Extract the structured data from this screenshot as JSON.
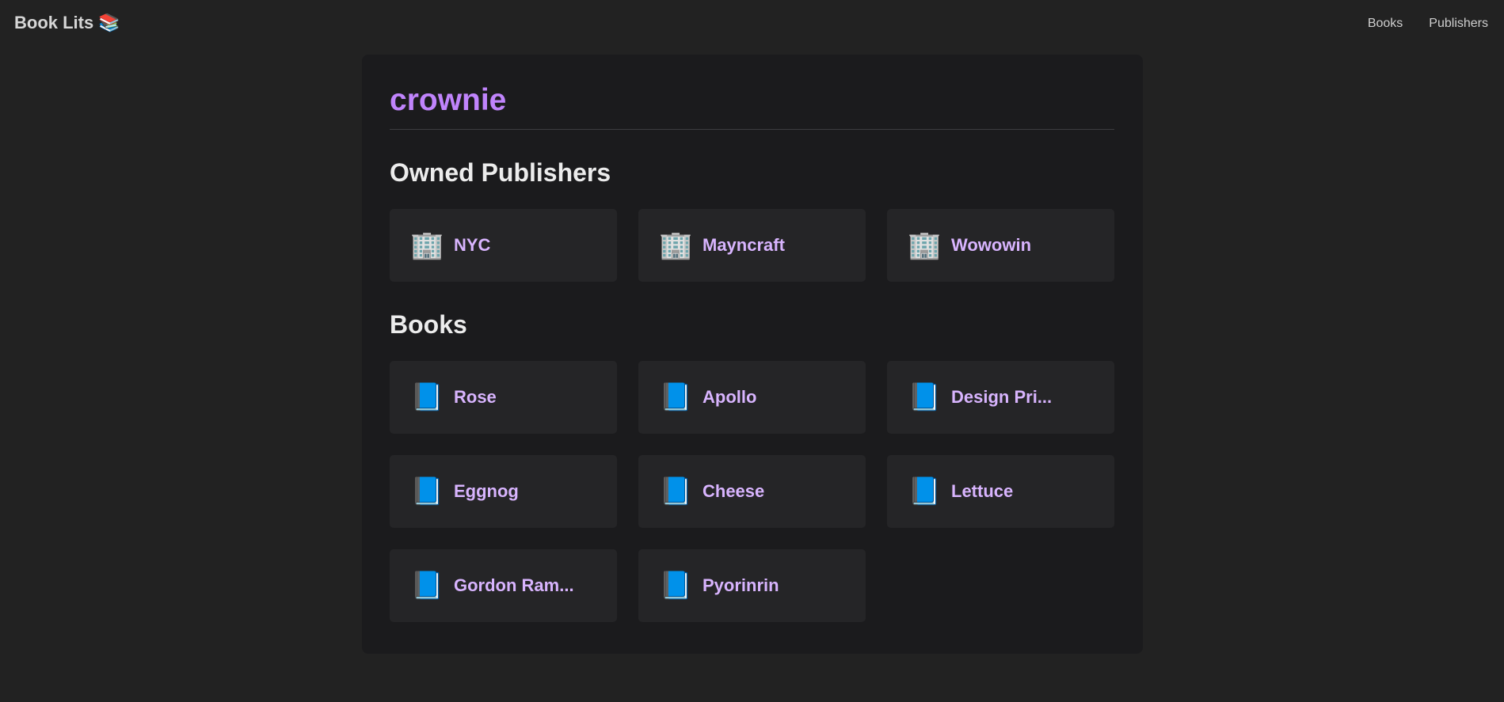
{
  "header": {
    "brand": "Book Lits",
    "brand_icon": "📚",
    "nav": [
      {
        "label": "Books"
      },
      {
        "label": "Publishers"
      }
    ]
  },
  "profile": {
    "username": "crownie"
  },
  "publishers": {
    "title": "Owned Publishers",
    "icon": "🏢",
    "items": [
      {
        "name": "NYC"
      },
      {
        "name": "Mayncraft"
      },
      {
        "name": "Wowowin"
      }
    ]
  },
  "books": {
    "title": "Books",
    "icon": "📘",
    "items": [
      {
        "name": "Rose"
      },
      {
        "name": "Apollo"
      },
      {
        "name": "Design Pri..."
      },
      {
        "name": "Eggnog"
      },
      {
        "name": "Cheese"
      },
      {
        "name": "Lettuce"
      },
      {
        "name": "Gordon Ram..."
      },
      {
        "name": "Pyorinrin"
      }
    ]
  },
  "colors": {
    "page_bg": "#222222",
    "panel_bg": "#1b1b1d",
    "card_bg": "#252527",
    "accent": "#c084fc",
    "card_text": "#d8b4fe"
  }
}
